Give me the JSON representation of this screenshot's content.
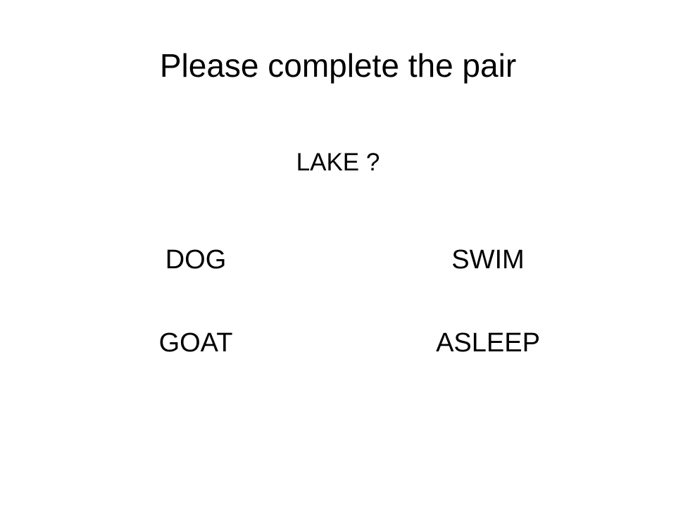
{
  "slide": {
    "title": "Please complete the pair",
    "prompt": "LAKE ?",
    "options": [
      "DOG",
      "SWIM",
      "GOAT",
      "ASLEEP"
    ]
  }
}
